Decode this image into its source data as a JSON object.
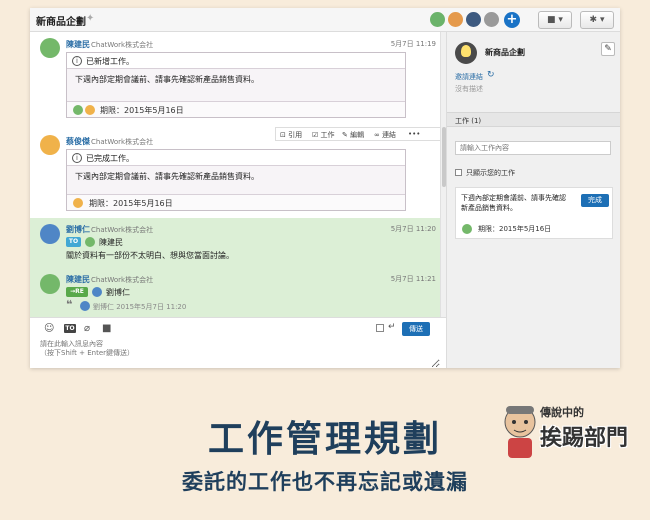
{
  "header": {
    "room_title": "新商品企劃",
    "file_menu": "▾",
    "settings_menu": "▾"
  },
  "messages": [
    {
      "sender": "陳建民",
      "org": "ChatWork株式会社",
      "time": "5月7日 11:19",
      "task_header": "已新增工作。",
      "task_body": "下週內部定期會議前、請事先確認新產品銷售資料。",
      "task_due": "期限：2015年5月16日"
    },
    {
      "sender": "蔡俊傑",
      "org": "ChatWork株式会社",
      "task_header": "已完成工作。",
      "task_body": "下週內部定期會議前、請事先確認新產品銷售資料。",
      "task_due": "期限：2015年5月16日"
    },
    {
      "sender": "劉博仁",
      "org": "ChatWork株式会社",
      "time": "5月7日 11:20",
      "to_badge": "TO",
      "to_name": "陳建民",
      "body": "關於資料有一部份不太明白、想與您當面討論。"
    },
    {
      "sender": "陳建民",
      "org": "ChatWork株式会社",
      "time": "5月7日 11:21",
      "re_badge": "→RE",
      "re_name": "劉博仁",
      "quote": "劉博仁  2015年5月7日 11:20"
    }
  ],
  "actions": {
    "quote": "引用",
    "task": "工作",
    "edit": "編輯",
    "link": "連結",
    "more": "•••"
  },
  "composer": {
    "to_label": "TO",
    "placeholder": "請在此輸入訊息內容\n（按下Shift + Enter鍵傳送）",
    "send": "傳送"
  },
  "sidebar": {
    "room_name": "新商品企劃",
    "invite": "邀請連結",
    "no_description": "沒有描述",
    "tasks_section": "工作 (1)",
    "task_input_placeholder": "請輸入工作內容",
    "only_mine": "只顯示您的工作",
    "task_text": "下週內部定期會議前、請事先確認新產品銷售資料。",
    "done_button": "完成",
    "task_due": "期限：2015年5月16日"
  },
  "caption": {
    "title": "工作管理規劃",
    "subtitle": "委託的工作也不再忘記或遺漏"
  },
  "logo": {
    "small": "傳說中的",
    "big": "挨踢部門"
  },
  "colors": {
    "accent": "#1d6fb5",
    "highlight_row": "#dcefd6",
    "caption_text": "#1f3f5c",
    "background": "#f8ecdb"
  }
}
